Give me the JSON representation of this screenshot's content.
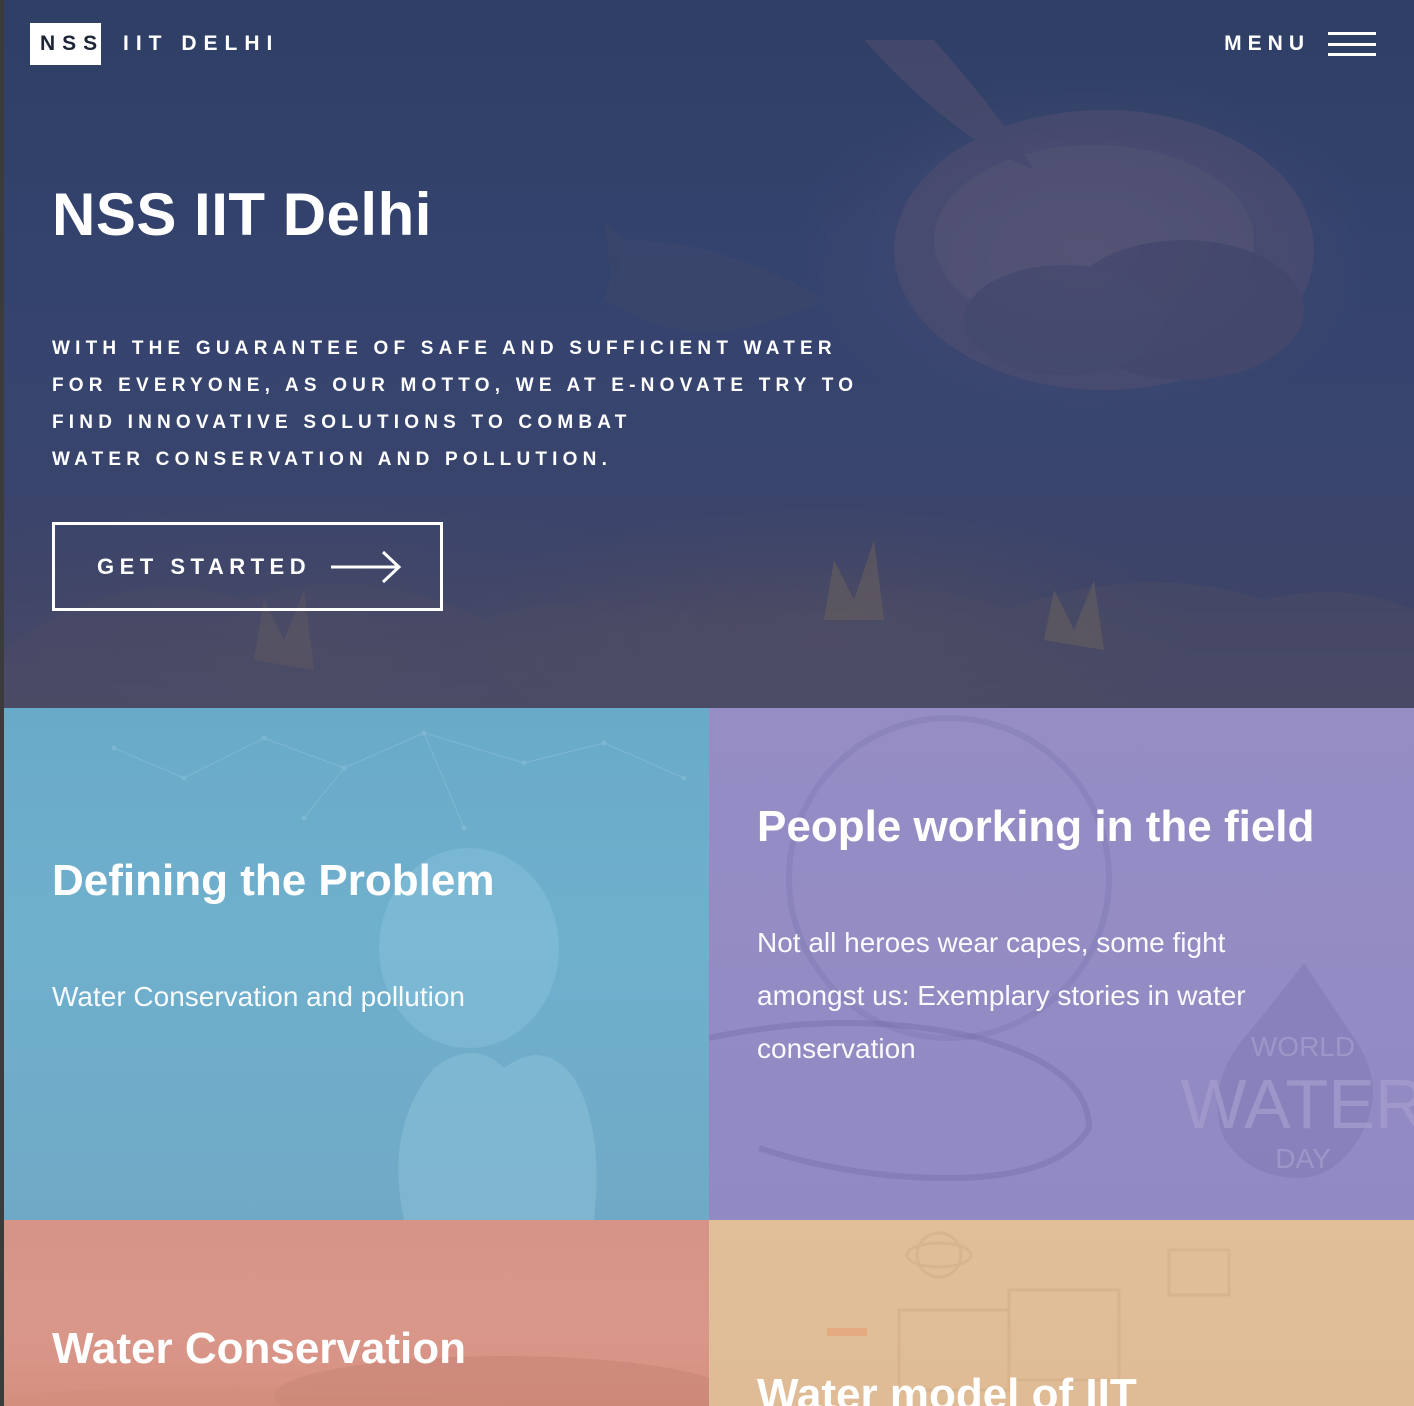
{
  "header": {
    "brand_box": "NSS",
    "brand_sub": "IIT DELHI",
    "menu_label": "MENU"
  },
  "hero": {
    "title": "NSS IIT Delhi",
    "lines": [
      "WITH THE GUARANTEE OF SAFE AND SUFFICIENT WATER",
      "FOR EVERYONE, AS OUR MOTTO, WE AT E-NOVATE TRY TO",
      "FIND INNOVATIVE SOLUTIONS TO COMBAT",
      "WATER CONSERVATION AND POLLUTION."
    ],
    "cta_label": "GET STARTED"
  },
  "tiles": [
    {
      "title": "Defining the Problem",
      "text": "Water Conservation and pollution",
      "color": "#6fb0cd"
    },
    {
      "title": "People working in the field",
      "text_lines": [
        "Not all heroes wear capes, some fight",
        "amongst us: Exemplary stories in water",
        "conservation"
      ],
      "art_label": [
        "WORLD",
        "WATER",
        "DAY"
      ],
      "color": "#938bc3"
    },
    {
      "title": "Water Conservation",
      "color": "#d9978a"
    },
    {
      "title": "Water model of IIT",
      "color": "#dfbc95"
    }
  ]
}
